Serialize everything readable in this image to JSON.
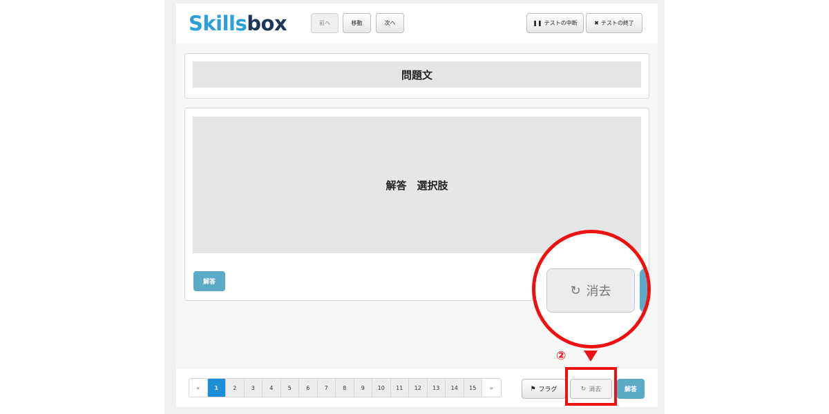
{
  "header": {
    "logo": {
      "part1": "Skills",
      "part2": "box"
    },
    "nav": {
      "prev_label": "前へ",
      "move_label": "移動",
      "next_label": "次へ"
    },
    "actions": {
      "pause_label": "テストの中断",
      "end_label": "テストの終了"
    }
  },
  "question": {
    "text": "問題文"
  },
  "answer": {
    "text": "解答　選択肢",
    "submit_label": "解答"
  },
  "footer": {
    "pagination": {
      "prev": "«",
      "next": "»",
      "pages": [
        "1",
        "2",
        "3",
        "4",
        "5",
        "6",
        "7",
        "8",
        "9",
        "10",
        "11",
        "12",
        "13",
        "14",
        "15"
      ],
      "current": "1"
    },
    "flag_label": "フラグ",
    "clear_label": "消去",
    "answer_label": "解答"
  },
  "annotation": {
    "step_marker": "②",
    "zoom_clear_label": "消去",
    "accent_color": "#ee1111"
  },
  "colors": {
    "logo_light": "#2a9fd8",
    "logo_dark": "#1e3657",
    "answer_button": "#5aaac8",
    "active_page": "#1a8fd8"
  }
}
